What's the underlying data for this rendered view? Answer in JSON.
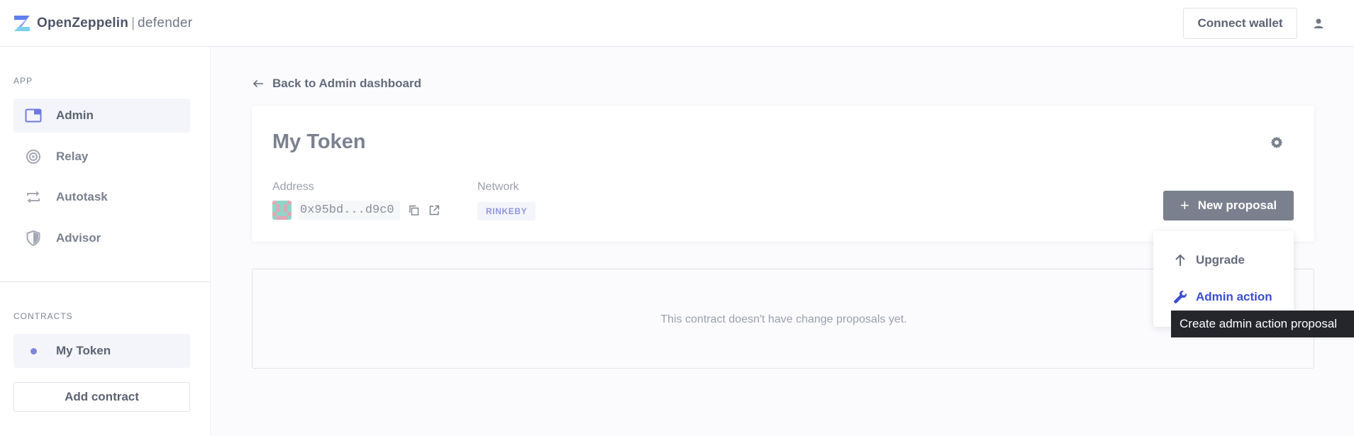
{
  "header": {
    "brand": "OpenZeppelin",
    "separator": "|",
    "product": "defender",
    "connect_wallet": "Connect wallet",
    "user_icon": "user-icon"
  },
  "sidebar": {
    "app_label": "APP",
    "items": [
      {
        "label": "Admin",
        "icon": "admin-window-icon",
        "active": true
      },
      {
        "label": "Relay",
        "icon": "relay-signal-icon",
        "active": false
      },
      {
        "label": "Autotask",
        "icon": "autotask-repeat-icon",
        "active": false
      },
      {
        "label": "Advisor",
        "icon": "advisor-shield-icon",
        "active": false
      }
    ],
    "contracts_label": "CONTRACTS",
    "contracts": [
      {
        "label": "My Token",
        "icon": "dot-icon"
      }
    ],
    "add_contract": "Add contract"
  },
  "main": {
    "back_label": "Back to Admin dashboard",
    "title": "My Token",
    "address_label": "Address",
    "address_value": "0x95bd...d9c0",
    "network_label": "Network",
    "network_value": "RINKEBY",
    "new_proposal": "New proposal",
    "empty_message": "This contract doesn't have change proposals yet."
  },
  "dropdown": {
    "items": [
      {
        "label": "Upgrade",
        "icon": "arrow-up-icon"
      },
      {
        "label": "Admin action",
        "icon": "wrench-icon"
      }
    ],
    "tooltip": "Create admin action proposal"
  },
  "colors": {
    "accent": "#3b4ed1",
    "primary_button": "#7a808d",
    "badge_text": "#8f95e0",
    "tooltip_bg": "#24262c"
  }
}
